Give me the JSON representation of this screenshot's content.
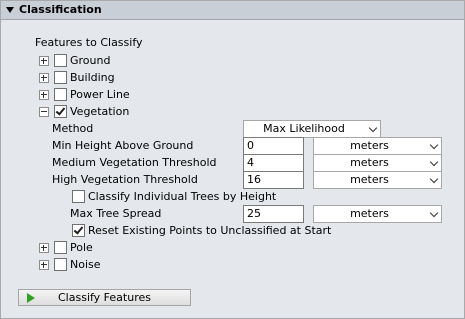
{
  "section": {
    "title": "Classification"
  },
  "features": {
    "heading": "Features to Classify",
    "items": [
      {
        "label": "Ground",
        "checked": false,
        "expanded": false
      },
      {
        "label": "Building",
        "checked": false,
        "expanded": false
      },
      {
        "label": "Power Line",
        "checked": false,
        "expanded": false
      },
      {
        "label": "Vegetation",
        "checked": true,
        "expanded": true
      },
      {
        "label": "Pole",
        "checked": false,
        "expanded": false
      },
      {
        "label": "Noise",
        "checked": false,
        "expanded": false
      }
    ]
  },
  "vegetation": {
    "method_label": "Method",
    "method_value": "Max Likelihood",
    "min_height_label": "Min Height Above Ground",
    "min_height_value": "0",
    "min_height_unit": "meters",
    "medium_label": "Medium Vegetation Threshold",
    "medium_value": "4",
    "medium_unit": "meters",
    "high_label": "High Vegetation Threshold",
    "high_value": "16",
    "high_unit": "meters",
    "classify_trees_label": "Classify Individual Trees by Height",
    "classify_trees_checked": false,
    "max_tree_spread_label": "Max Tree Spread",
    "max_tree_spread_value": "25",
    "max_tree_spread_unit": "meters",
    "reset_points_label": "Reset Existing Points to Unclassified at Start",
    "reset_points_checked": true
  },
  "actions": {
    "classify_button_label": "Classify Features"
  },
  "colors": {
    "panel_background": "#e4e8ec",
    "header_background": "#c9cfd6",
    "play_icon": "#2fa020"
  },
  "icons": {
    "collapse": "triangle-down-icon",
    "expand": "plus-box-icon",
    "collapse_item": "minus-box-icon",
    "check": "check-icon",
    "dropdown": "chevron-down-icon",
    "run": "play-icon"
  }
}
